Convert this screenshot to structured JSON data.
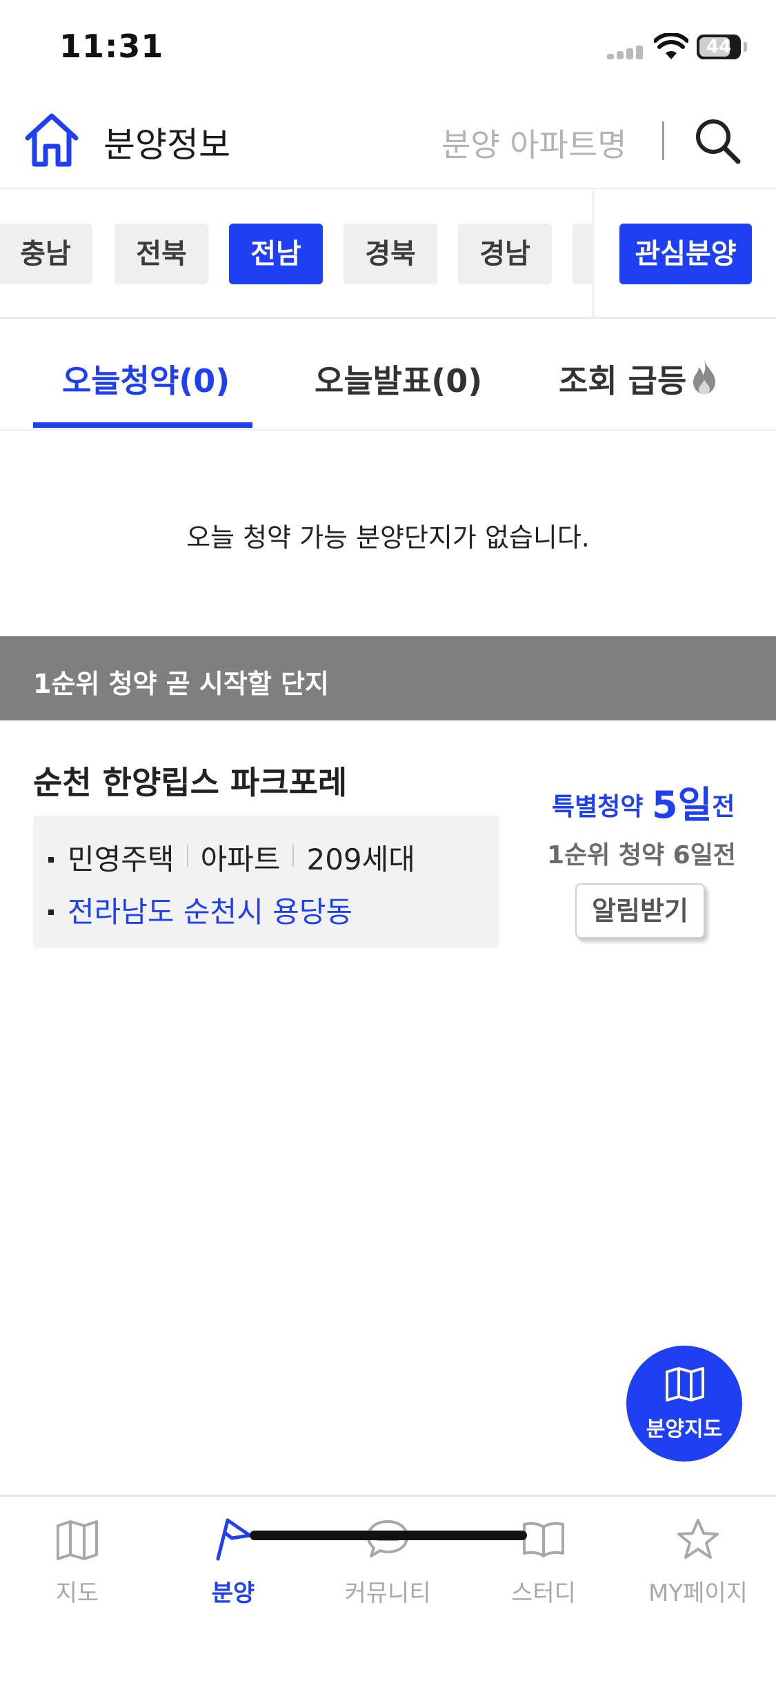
{
  "status_bar": {
    "time": "11:31",
    "battery": "44"
  },
  "header": {
    "title": "분양정보",
    "search_placeholder": "분양 아파트명",
    "icons": [
      "home-icon",
      "search-icon"
    ]
  },
  "regions": {
    "chips": [
      {
        "label": "충남",
        "active": false
      },
      {
        "label": "전북",
        "active": false
      },
      {
        "label": "전남",
        "active": true
      },
      {
        "label": "경북",
        "active": false
      },
      {
        "label": "경남",
        "active": false
      }
    ],
    "favorite_label": "관심분양"
  },
  "tabs": [
    {
      "label": "오늘청약(0)",
      "active": true
    },
    {
      "label": "오늘발표(0)",
      "active": false
    },
    {
      "label": "조회 급등",
      "active": false,
      "icon": "fire-icon"
    }
  ],
  "empty_message": "오늘 청약 가능 분양단지가 없습니다.",
  "section": {
    "title": "1순위 청약 곧 시작할 단지"
  },
  "complex": {
    "name": "순천 한양립스 파크포레",
    "type": "민영주택",
    "building": "아파트",
    "units": "209세대",
    "address": "전라남도 순천시 용당동",
    "special_prefix": "특별청약 ",
    "special_days": "5일",
    "special_suffix": "전",
    "first_rank": "1순위 청약 6일전",
    "alert_button": "알림받기"
  },
  "fab": {
    "label": "분양지도",
    "icon": "map-icon"
  },
  "bottom_nav": [
    {
      "label": "지도",
      "icon": "map-icon",
      "active": false
    },
    {
      "label": "분양",
      "icon": "flag-icon",
      "active": true
    },
    {
      "label": "커뮤니티",
      "icon": "chat-icon",
      "active": false
    },
    {
      "label": "스터디",
      "icon": "book-icon",
      "active": false
    },
    {
      "label": "MY페이지",
      "icon": "star-icon",
      "active": false
    }
  ],
  "colors": {
    "accent": "#1f3ff2",
    "section_bg": "#7f7f7f",
    "chip_bg": "#eeeff1",
    "inactive": "#a8a8a8"
  }
}
